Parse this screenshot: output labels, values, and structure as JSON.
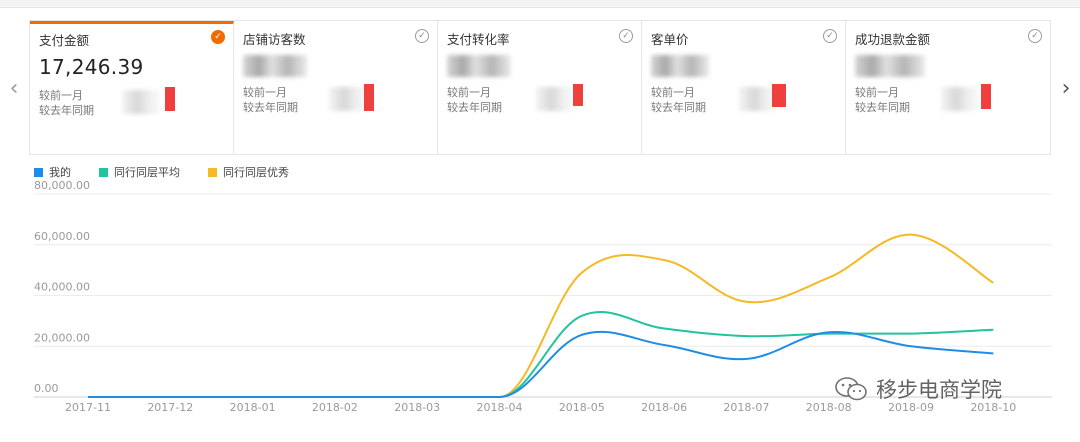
{
  "metrics": [
    {
      "title": "支付金额",
      "value": "17,246.39",
      "value_visible": true,
      "cmp_month": "较前一月",
      "cmp_year": "较去年同期",
      "selected": true
    },
    {
      "title": "店铺访客数",
      "value": "",
      "value_visible": false,
      "cmp_month": "较前一月",
      "cmp_year": "较去年同期",
      "selected": false
    },
    {
      "title": "支付转化率",
      "value": "",
      "value_visible": false,
      "cmp_month": "较前一月",
      "cmp_year": "较去年同期",
      "selected": false
    },
    {
      "title": "客单价",
      "value": "",
      "value_visible": false,
      "cmp_month": "较前一月",
      "cmp_year": "较去年同期",
      "selected": false
    },
    {
      "title": "成功退款金额",
      "value": "",
      "value_visible": false,
      "cmp_month": "较前一月",
      "cmp_year": "较去年同期",
      "selected": false
    }
  ],
  "colors": {
    "accent": "#f06b00",
    "indicator_red": "#f0403e",
    "series_mine": "#1f8ce6",
    "series_avg": "#22c39d",
    "series_top": "#f5b925"
  },
  "icons": {
    "prev": "chevron-left-icon",
    "next": "chevron-right-icon",
    "check": "check-circle-icon",
    "watermark": "wechat-icon"
  },
  "watermark_text": "移步电商学院",
  "chart_data": {
    "type": "line",
    "x": [
      "2017-11",
      "2017-12",
      "2018-01",
      "2018-02",
      "2018-03",
      "2018-04",
      "2018-05",
      "2018-06",
      "2018-07",
      "2018-08",
      "2018-09",
      "2018-10"
    ],
    "ylim": [
      0,
      80000
    ],
    "yticks": [
      "0.00",
      "20,000.00",
      "40,000.00",
      "60,000.00",
      "80,000.00"
    ],
    "grid": true,
    "legend_position": "top-left",
    "series": [
      {
        "name": "我的",
        "color": "#1f8ce6",
        "values": [
          0,
          0,
          0,
          0,
          0,
          0,
          24500,
          20500,
          15000,
          25500,
          20000,
          17200
        ]
      },
      {
        "name": "同行同层平均",
        "color": "#22c39d",
        "values": [
          0,
          0,
          0,
          0,
          0,
          0,
          32000,
          27000,
          24000,
          25000,
          25000,
          26500
        ]
      },
      {
        "name": "同行同层优秀",
        "color": "#f5b925",
        "values": [
          0,
          0,
          0,
          0,
          0,
          0,
          49000,
          54000,
          37500,
          47000,
          64000,
          45000
        ]
      }
    ]
  }
}
